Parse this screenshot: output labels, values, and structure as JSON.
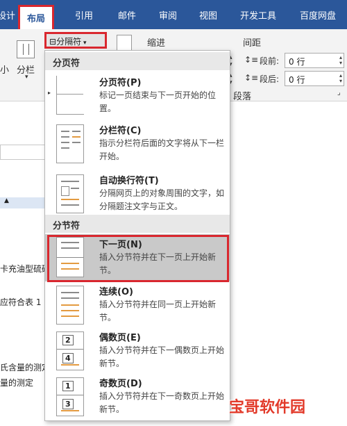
{
  "tabs": [
    "设计",
    "布局",
    "引用",
    "邮件",
    "审阅",
    "视图",
    "开发工具",
    "百度网盘"
  ],
  "ribbon": {
    "size_label": "小",
    "columns_label": "分栏",
    "breaks_button": "分隔符",
    "indent_label": "缩进",
    "spacing_label": "间距",
    "before_label": "段前:",
    "before_value": "0 行",
    "after_label": "段后:",
    "after_value": "0 行",
    "paragraph_group": "段落"
  },
  "menu": {
    "page_breaks_header": "分页符",
    "section_breaks_header": "分节符",
    "items": [
      {
        "title": "分页符(P)",
        "desc": "标记一页结束与下一页开始的位置。"
      },
      {
        "title": "分栏符(C)",
        "desc": "指示分栏符后面的文字将从下一栏开始。"
      },
      {
        "title": "自动换行符(T)",
        "desc": "分隔网页上的对象周围的文字，如分隔题注文字与正文。"
      },
      {
        "title": "下一页(N)",
        "desc": "插入分节符并在下一页上开始新节。"
      },
      {
        "title": "连续(O)",
        "desc": "插入分节符并在同一页上开始新节。"
      },
      {
        "title": "偶数页(E)",
        "desc": "插入分节符并在下一偶数页上开始新节。"
      },
      {
        "title": "奇数页(D)",
        "desc": "插入分节符并在下一奇数页上开始新节。"
      }
    ],
    "even_icon_nums": [
      "2",
      "4"
    ],
    "odd_icon_nums": [
      "1",
      "3"
    ]
  },
  "document": {
    "lines": [
      "卡充油型硫磷",
      "应符合表 1",
      "氏含量的测定",
      "量的测定"
    ]
  },
  "watermark": "宝哥软件园"
}
